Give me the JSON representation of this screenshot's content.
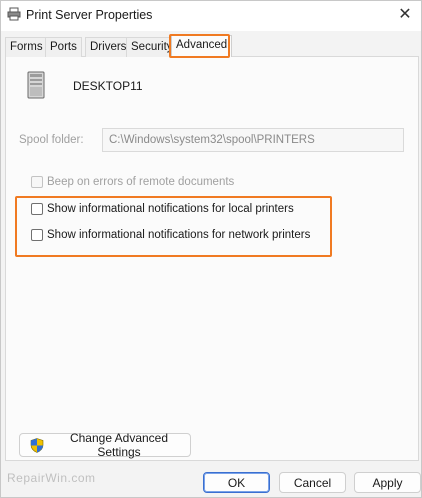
{
  "window": {
    "title": "Print Server Properties",
    "close_glyph": "✕"
  },
  "tabs": [
    {
      "label": "Forms"
    },
    {
      "label": "Ports"
    },
    {
      "label": "Drivers"
    },
    {
      "label": "Security"
    },
    {
      "label": "Advanced"
    }
  ],
  "active_tab": "Advanced",
  "server": {
    "name": "DESKTOP11",
    "icon": "server-tower-icon"
  },
  "spool": {
    "label": "Spool folder:",
    "value": "C:\\Windows\\system32\\spool\\PRINTERS"
  },
  "checkboxes": {
    "beep": {
      "label": "Beep on errors of remote documents",
      "checked": false,
      "enabled": false
    },
    "local": {
      "label": "Show informational notifications for local printers",
      "checked": false,
      "enabled": true
    },
    "network": {
      "label": "Show informational notifications for network printers",
      "checked": false,
      "enabled": true
    }
  },
  "advanced_button": {
    "label": "Change Advanced Settings",
    "icon": "uac-shield-icon"
  },
  "buttons": {
    "ok": "OK",
    "cancel": "Cancel",
    "apply": "Apply"
  },
  "watermark": "RepairWin.com",
  "colors": {
    "highlight": "#f07a22",
    "default_button_border": "#3a6fd0"
  }
}
